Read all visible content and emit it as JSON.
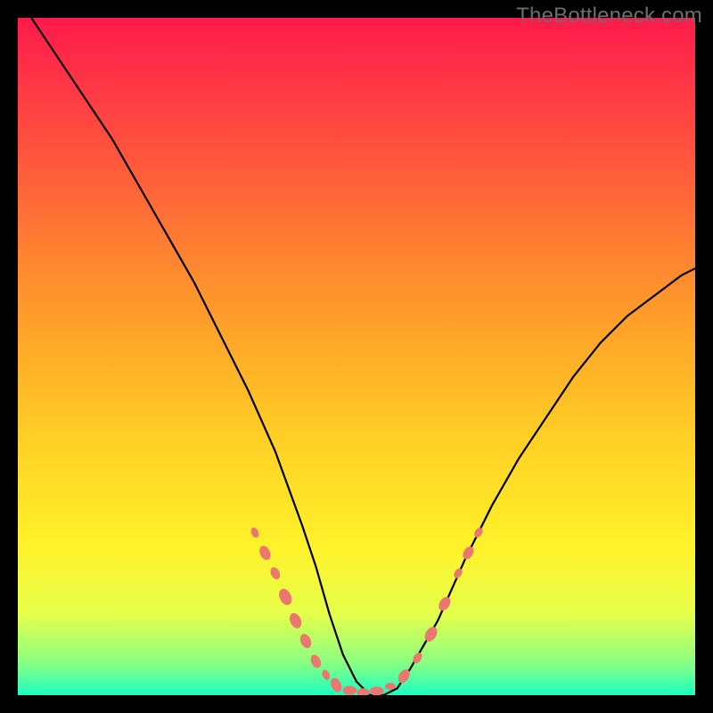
{
  "watermark": "TheBottleneck.com",
  "colors": {
    "page_bg": "#000000",
    "curve_stroke": "#000000",
    "bead_fill": "#e9786f",
    "gradient_stops": [
      "#ff1a4b",
      "#ff3745",
      "#ff5a3c",
      "#ff8330",
      "#ffa828",
      "#ffcf25",
      "#fff22a",
      "#e6ff4a",
      "#8dff80",
      "#1bffc1"
    ]
  },
  "chart_data": {
    "type": "line",
    "title": "",
    "xlabel": "",
    "ylabel": "",
    "xlim": [
      0,
      100
    ],
    "ylim": [
      0,
      100
    ],
    "series": [
      {
        "name": "bottleneck-curve",
        "x": [
          2,
          6,
          10,
          14,
          18,
          22,
          26,
          30,
          34,
          38,
          42,
          44,
          46,
          48,
          50,
          52,
          54,
          56,
          58,
          62,
          66,
          70,
          74,
          78,
          82,
          86,
          90,
          94,
          98,
          100
        ],
        "y": [
          100,
          94,
          88,
          82,
          75,
          68,
          61,
          53,
          45,
          36,
          25,
          19,
          12,
          6,
          2,
          0,
          0,
          1,
          4,
          11,
          20,
          28,
          35,
          41,
          47,
          52,
          56,
          59,
          62,
          63
        ]
      }
    ],
    "markers": {
      "name": "highlight-beads",
      "points": [
        {
          "x": 35,
          "y": 24,
          "r": 1.0
        },
        {
          "x": 36.5,
          "y": 21,
          "r": 1.4
        },
        {
          "x": 38,
          "y": 18,
          "r": 1.2
        },
        {
          "x": 39.5,
          "y": 14.5,
          "r": 1.6
        },
        {
          "x": 41,
          "y": 11,
          "r": 1.5
        },
        {
          "x": 42.5,
          "y": 8,
          "r": 1.4
        },
        {
          "x": 44,
          "y": 5,
          "r": 1.3
        },
        {
          "x": 45.5,
          "y": 3,
          "r": 1.0
        },
        {
          "x": 47,
          "y": 1.5,
          "r": 1.4
        },
        {
          "x": 49,
          "y": 0.7,
          "r": 1.3
        },
        {
          "x": 51,
          "y": 0.4,
          "r": 1.2
        },
        {
          "x": 53,
          "y": 0.6,
          "r": 1.3
        },
        {
          "x": 55,
          "y": 1.3,
          "r": 1.0
        },
        {
          "x": 57,
          "y": 2.8,
          "r": 1.4
        },
        {
          "x": 59,
          "y": 5.5,
          "r": 1.1
        },
        {
          "x": 61,
          "y": 9,
          "r": 1.5
        },
        {
          "x": 63,
          "y": 13.5,
          "r": 1.4
        },
        {
          "x": 65,
          "y": 18,
          "r": 1.0
        },
        {
          "x": 66.5,
          "y": 21,
          "r": 1.3
        },
        {
          "x": 68,
          "y": 24,
          "r": 1.0
        }
      ]
    }
  }
}
